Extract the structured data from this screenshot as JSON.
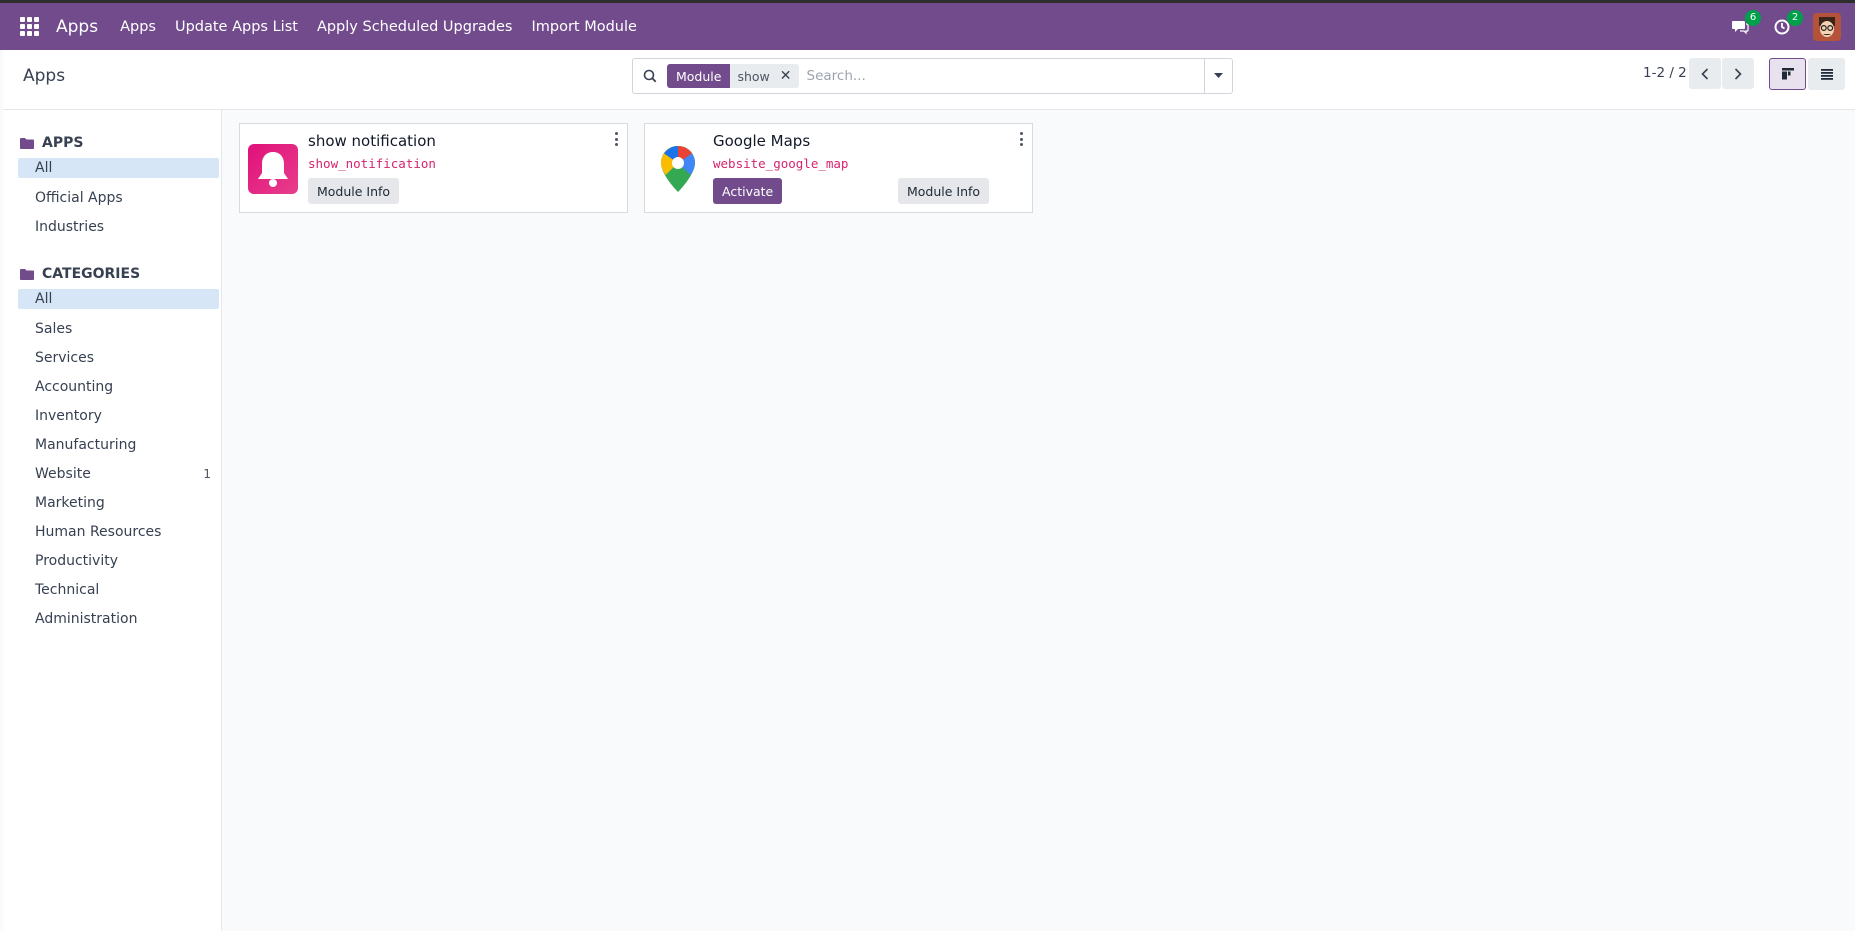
{
  "topbar": {
    "brand": "Apps",
    "menu": [
      "Apps",
      "Update Apps List",
      "Apply Scheduled Upgrades",
      "Import Module"
    ],
    "messages_count": "6",
    "activities_count": "2"
  },
  "control": {
    "breadcrumb": "Apps",
    "search": {
      "facet_label": "Module",
      "facet_value": "show",
      "placeholder": "Search..."
    },
    "pager": "1-2 / 2"
  },
  "sidebar": {
    "sections": [
      {
        "title": "APPS",
        "items": [
          {
            "label": "All",
            "active": true,
            "count": ""
          },
          {
            "label": "Official Apps",
            "active": false,
            "count": ""
          },
          {
            "label": "Industries",
            "active": false,
            "count": ""
          }
        ]
      },
      {
        "title": "CATEGORIES",
        "items": [
          {
            "label": "All",
            "active": true,
            "count": ""
          },
          {
            "label": "Sales",
            "active": false,
            "count": ""
          },
          {
            "label": "Services",
            "active": false,
            "count": ""
          },
          {
            "label": "Accounting",
            "active": false,
            "count": ""
          },
          {
            "label": "Inventory",
            "active": false,
            "count": ""
          },
          {
            "label": "Manufacturing",
            "active": false,
            "count": ""
          },
          {
            "label": "Website",
            "active": false,
            "count": "1"
          },
          {
            "label": "Marketing",
            "active": false,
            "count": ""
          },
          {
            "label": "Human Resources",
            "active": false,
            "count": ""
          },
          {
            "label": "Productivity",
            "active": false,
            "count": ""
          },
          {
            "label": "Technical",
            "active": false,
            "count": ""
          },
          {
            "label": "Administration",
            "active": false,
            "count": ""
          }
        ]
      }
    ]
  },
  "cards": [
    {
      "name": "show notification",
      "technical_name": "show_notification",
      "icon": "bell-icon",
      "info_label": "Module Info",
      "activate_label": ""
    },
    {
      "name": "Google Maps",
      "technical_name": "website_google_map",
      "icon": "map-pin-icon",
      "info_label": "Module Info",
      "activate_label": "Activate"
    }
  ],
  "colors": {
    "brand": "#714b8c",
    "badge": "#00a04a",
    "active_item": "#d6e6f7",
    "technical_name": "#d6246e"
  }
}
